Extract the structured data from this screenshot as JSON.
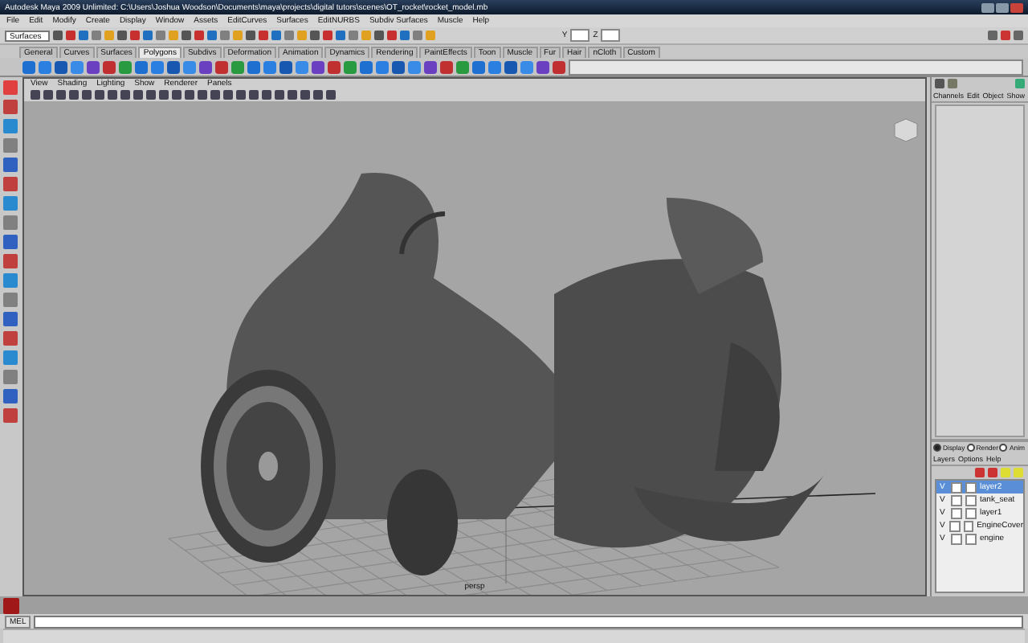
{
  "window": {
    "title": "Autodesk Maya 2009 Unlimited: C:\\Users\\Joshua Woodson\\Documents\\maya\\projects\\digital tutors\\scenes\\OT_rocket\\rocket_model.mb"
  },
  "menu_bar": [
    "File",
    "Edit",
    "Modify",
    "Create",
    "Display",
    "Window",
    "Assets",
    "EditCurves",
    "Surfaces",
    "EditNURBS",
    "Subdiv Surfaces",
    "Muscle",
    "Help"
  ],
  "status_line": {
    "menu_set": "Surfaces",
    "field_labels": [
      "Y",
      "Z"
    ]
  },
  "shelf": {
    "tabs": [
      {
        "label": "General",
        "selected": false
      },
      {
        "label": "Curves",
        "selected": false
      },
      {
        "label": "Surfaces",
        "selected": false
      },
      {
        "label": "Polygons",
        "selected": true
      },
      {
        "label": "Subdivs",
        "selected": false
      },
      {
        "label": "Deformation",
        "selected": false
      },
      {
        "label": "Animation",
        "selected": false
      },
      {
        "label": "Dynamics",
        "selected": false
      },
      {
        "label": "Rendering",
        "selected": false
      },
      {
        "label": "PaintEffects",
        "selected": false
      },
      {
        "label": "Toon",
        "selected": false
      },
      {
        "label": "Muscle",
        "selected": false
      },
      {
        "label": "Fur",
        "selected": false
      },
      {
        "label": "Hair",
        "selected": false
      },
      {
        "label": "nCloth",
        "selected": false
      },
      {
        "label": "Custom",
        "selected": false
      }
    ]
  },
  "viewport": {
    "menus": [
      "View",
      "Shading",
      "Lighting",
      "Show",
      "Renderer",
      "Panels"
    ],
    "camera_label": "persp"
  },
  "channel_box": {
    "menus": [
      "Channels",
      "Edit",
      "Object",
      "Show"
    ]
  },
  "layer_editor": {
    "modes": [
      {
        "label": "Display",
        "selected": true
      },
      {
        "label": "Render",
        "selected": false
      },
      {
        "label": "Anim",
        "selected": false
      }
    ],
    "menus": [
      "Layers",
      "Options",
      "Help"
    ],
    "layers": [
      {
        "visibility": "V",
        "name": "layer2",
        "selected": true
      },
      {
        "visibility": "V",
        "name": "tank_seat",
        "selected": false
      },
      {
        "visibility": "V",
        "name": "layer1",
        "selected": false
      },
      {
        "visibility": "V",
        "name": "EngineCover",
        "selected": false
      },
      {
        "visibility": "V",
        "name": "engine",
        "selected": false
      }
    ]
  },
  "command_line": {
    "language": "MEL"
  }
}
